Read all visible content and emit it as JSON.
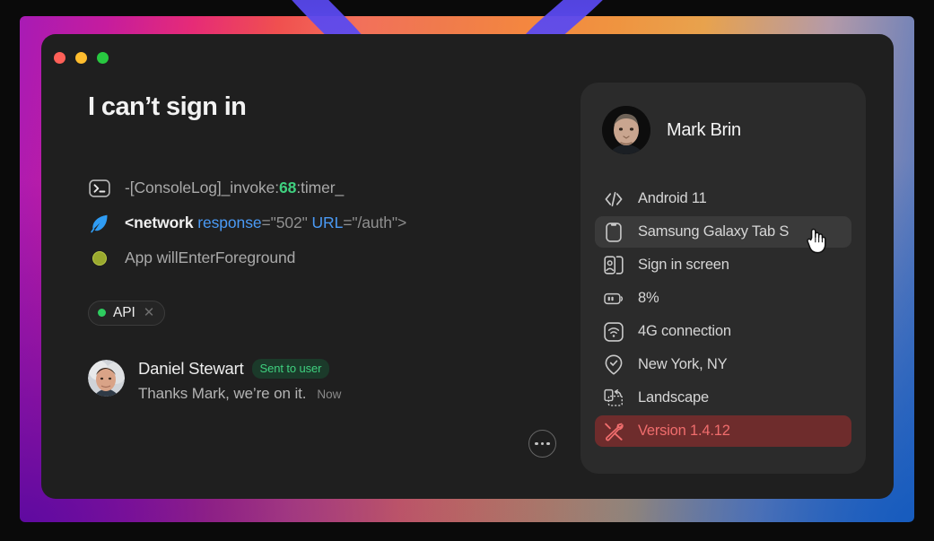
{
  "window": {
    "traffic_lights": [
      {
        "name": "close",
        "color": "#ff6058"
      },
      {
        "name": "minimize",
        "color": "#ffbd2e"
      },
      {
        "name": "zoom",
        "color": "#28c840"
      }
    ]
  },
  "content": {
    "title": "I can’t sign in",
    "logs": [
      {
        "icon": "terminal-icon",
        "segments": [
          {
            "text": "-[ConsoleLog]_invoke:",
            "style": "plain"
          },
          {
            "text": "68",
            "style": "num"
          },
          {
            "text": ":timer_",
            "style": "plain"
          }
        ]
      },
      {
        "icon": "feather-icon",
        "segments": [
          {
            "text": "<network",
            "style": "tag"
          },
          {
            "text": " ",
            "style": "plain"
          },
          {
            "text": "response",
            "style": "attr"
          },
          {
            "text": "=\"502\" ",
            "style": "dim"
          },
          {
            "text": "URL",
            "style": "attr"
          },
          {
            "text": "=\"/auth\">",
            "style": "dim"
          }
        ]
      },
      {
        "icon": "status-circle-icon",
        "segments": [
          {
            "text": "App willEnterForeground",
            "style": "plain"
          }
        ]
      }
    ],
    "chip": {
      "label": "API",
      "dot_color": "#2ecc5f",
      "close_glyph": "✕"
    },
    "message": {
      "author": "Daniel Stewart",
      "badge": "Sent to user",
      "text": "Thanks Mark, we’re on it.",
      "time": "Now"
    },
    "more_button_label": "More options"
  },
  "panel": {
    "user_name": "Mark Brin",
    "items": [
      {
        "icon": "code-icon",
        "label": "Android 11",
        "state": "normal"
      },
      {
        "icon": "phone-icon",
        "label": "Samsung Galaxy Tab S",
        "state": "hovered"
      },
      {
        "icon": "screen-user-icon",
        "label": "Sign in screen",
        "state": "normal"
      },
      {
        "icon": "battery-icon",
        "label": "8%",
        "state": "normal"
      },
      {
        "icon": "wifi-icon",
        "label": "4G connection",
        "state": "normal"
      },
      {
        "icon": "location-icon",
        "label": "New York, NY",
        "state": "normal"
      },
      {
        "icon": "rotate-icon",
        "label": "Landscape",
        "state": "normal"
      },
      {
        "icon": "tools-icon",
        "label": "Version 1.4.12",
        "state": "alert"
      }
    ]
  },
  "theme": {
    "window_bg": "#1f1f1f",
    "panel_bg": "#2b2b2b",
    "accent_green": "#3fd07f",
    "accent_blue": "#4a9af5",
    "alert_red": "#f06d6d",
    "alert_bg": "#6e2c2c",
    "hover_bg": "#3a3a3a"
  }
}
